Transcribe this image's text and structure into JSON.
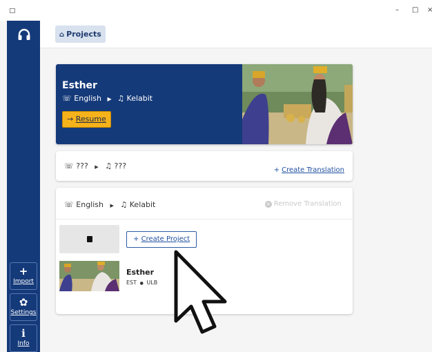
{
  "window": {
    "minimize_glyph": "–",
    "maximize_glyph": "□",
    "close_glyph": "×"
  },
  "sidebar": {
    "logo_icon": "headphones-icon",
    "items": [
      {
        "icon": "plus-icon",
        "glyph": "+",
        "label": "Import"
      },
      {
        "icon": "gear-icon",
        "glyph": "✿",
        "label": "Settings"
      },
      {
        "icon": "info-icon",
        "glyph": "i",
        "label": "Info"
      }
    ]
  },
  "breadcrumb": {
    "icon": "home-icon",
    "label": "Projects"
  },
  "hero": {
    "title": "Esther",
    "source_language": "English",
    "target_language": "Kelabit",
    "resume_arrow": "→",
    "resume_label": "Resume"
  },
  "empty_translation": {
    "source_language": "???",
    "target_language": "???",
    "create_plus": "+",
    "create_label": "Create Translation"
  },
  "translation": {
    "source_language": "English",
    "target_language": "Kelabit",
    "remove_label": "Remove Translation",
    "create_plus": "+",
    "create_project_label": "Create Project",
    "project": {
      "title": "Esther",
      "code": "EST",
      "resource": "ULB",
      "separator": "●"
    }
  },
  "colors": {
    "sidebar": "#153a7a",
    "accent": "#f6b21b",
    "link": "#1f4fa0"
  }
}
